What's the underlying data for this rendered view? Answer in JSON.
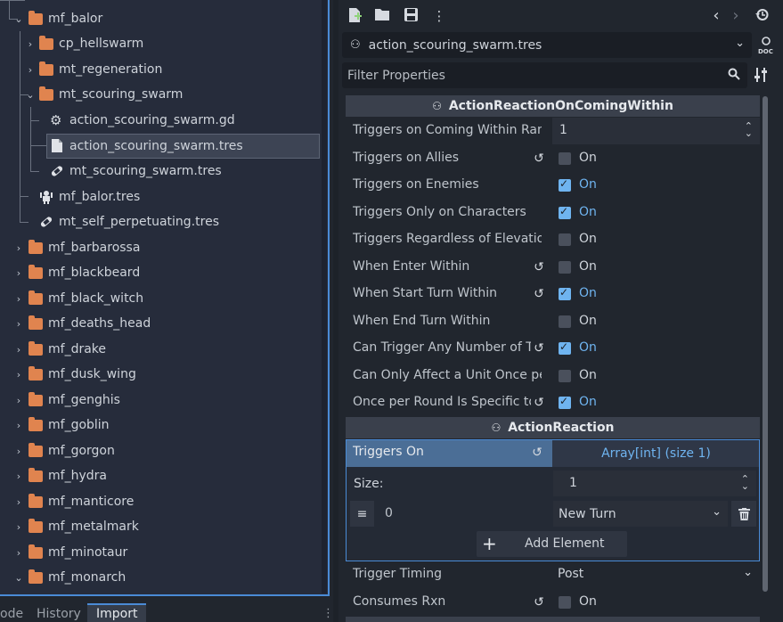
{
  "filesystem": {
    "items": [
      {
        "label": "mf_balor",
        "type": "folder",
        "expanded": true
      },
      {
        "label": "cp_hellswarm",
        "type": "folder",
        "expanded": false
      },
      {
        "label": "mt_regeneration",
        "type": "folder",
        "expanded": false
      },
      {
        "label": "mt_scouring_swarm",
        "type": "folder",
        "expanded": true
      },
      {
        "label": "action_scouring_swarm.gd",
        "type": "script"
      },
      {
        "label": "action_scouring_swarm.tres",
        "type": "resource",
        "selected": true
      },
      {
        "label": "mt_scouring_swarm.tres",
        "type": "resource"
      },
      {
        "label": "mf_balor.tres",
        "type": "resource"
      },
      {
        "label": "mt_self_perpetuating.tres",
        "type": "resource"
      },
      {
        "label": "mf_barbarossa",
        "type": "folder"
      },
      {
        "label": "mf_blackbeard",
        "type": "folder"
      },
      {
        "label": "mf_black_witch",
        "type": "folder"
      },
      {
        "label": "mf_deaths_head",
        "type": "folder"
      },
      {
        "label": "mf_drake",
        "type": "folder"
      },
      {
        "label": "mf_dusk_wing",
        "type": "folder"
      },
      {
        "label": "mf_genghis",
        "type": "folder"
      },
      {
        "label": "mf_goblin",
        "type": "folder"
      },
      {
        "label": "mf_gorgon",
        "type": "folder"
      },
      {
        "label": "mf_hydra",
        "type": "folder"
      },
      {
        "label": "mf_manticore",
        "type": "folder"
      },
      {
        "label": "mf_metalmark",
        "type": "folder"
      },
      {
        "label": "mf_minotaur",
        "type": "folder"
      },
      {
        "label": "mf_monarch",
        "type": "folder",
        "expanded": true
      }
    ],
    "folder_color": "#e0844f"
  },
  "bottom_tabs": [
    {
      "label": "ode"
    },
    {
      "label": "History"
    },
    {
      "label": "Import",
      "active": true
    }
  ],
  "inspector": {
    "resource_name": "action_scouring_swarm.tres",
    "filter_placeholder": "Filter Properties",
    "section1": "ActionReactionOnComingWithin",
    "section2": "ActionReaction",
    "on_label": "On",
    "props": [
      {
        "name": "Triggers on Coming Within Rang",
        "kind": "number",
        "value": "1"
      },
      {
        "name": "Triggers on Allies",
        "kind": "bool",
        "checked": false,
        "revert": true
      },
      {
        "name": "Triggers on Enemies",
        "kind": "bool",
        "checked": true
      },
      {
        "name": "Triggers Only on Characters",
        "kind": "bool",
        "checked": true
      },
      {
        "name": "Triggers Regardless of Elevation",
        "kind": "bool",
        "checked": false
      },
      {
        "name": "When Enter Within",
        "kind": "bool",
        "checked": false,
        "revert": true
      },
      {
        "name": "When Start Turn Within",
        "kind": "bool",
        "checked": true,
        "revert": true
      },
      {
        "name": "When End Turn Within",
        "kind": "bool",
        "checked": false
      },
      {
        "name": "Can Trigger Any Number of Ti",
        "kind": "bool",
        "checked": true,
        "revert": true
      },
      {
        "name": "Can Only Affect a Unit Once per R",
        "kind": "bool",
        "checked": false
      },
      {
        "name": "Once per Round Is Specific to",
        "kind": "bool",
        "checked": true,
        "revert": true
      }
    ],
    "triggers_on": {
      "name": "Triggers On",
      "value": "Array[int] (size 1)"
    },
    "array": {
      "size_label": "Size:",
      "size_value": "1",
      "index": "0",
      "element_value": "New Turn",
      "add_label": "Add Element"
    },
    "trigger_timing": {
      "name": "Trigger Timing",
      "value": "Post"
    },
    "consumes_rxn": {
      "name": "Consumes Rxn",
      "checked": false
    },
    "accent_color": "#4a8bd6",
    "checked_color": "#6fb4f0"
  }
}
